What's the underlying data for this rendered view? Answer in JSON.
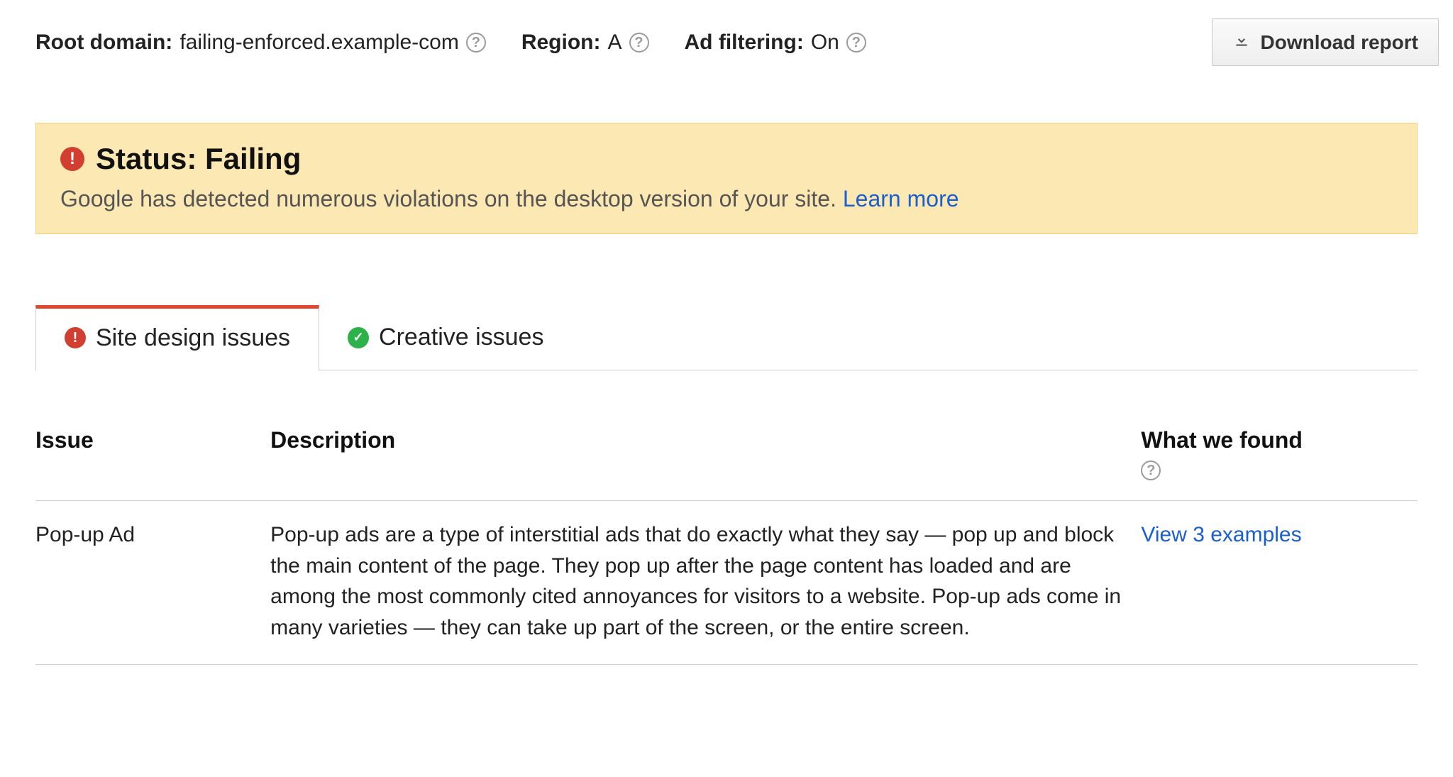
{
  "info": {
    "root_domain_label": "Root domain:",
    "root_domain_value": "failing-enforced.example-com",
    "region_label": "Region:",
    "region_value": "A",
    "ad_filtering_label": "Ad filtering:",
    "ad_filtering_value": "On"
  },
  "download_button_label": "Download report",
  "status": {
    "title": "Status: Failing",
    "description": "Google has detected numerous violations on the desktop version of your site.",
    "learn_more": "Learn more"
  },
  "tabs": [
    {
      "label": "Site design issues",
      "icon": "alert",
      "active": true
    },
    {
      "label": "Creative issues",
      "icon": "check",
      "active": false
    }
  ],
  "table": {
    "headers": {
      "issue": "Issue",
      "description": "Description",
      "found": "What we found"
    },
    "rows": [
      {
        "issue": "Pop-up Ad",
        "description": "Pop-up ads are a type of interstitial ads that do exactly what they say — pop up and block the main content of the page. They pop up after the page content has loaded and are among the most commonly cited annoyances for visitors to a website. Pop-up ads come in many varieties — they can take up part of the screen, or the entire screen.",
        "found_link": "View 3 examples"
      }
    ]
  }
}
